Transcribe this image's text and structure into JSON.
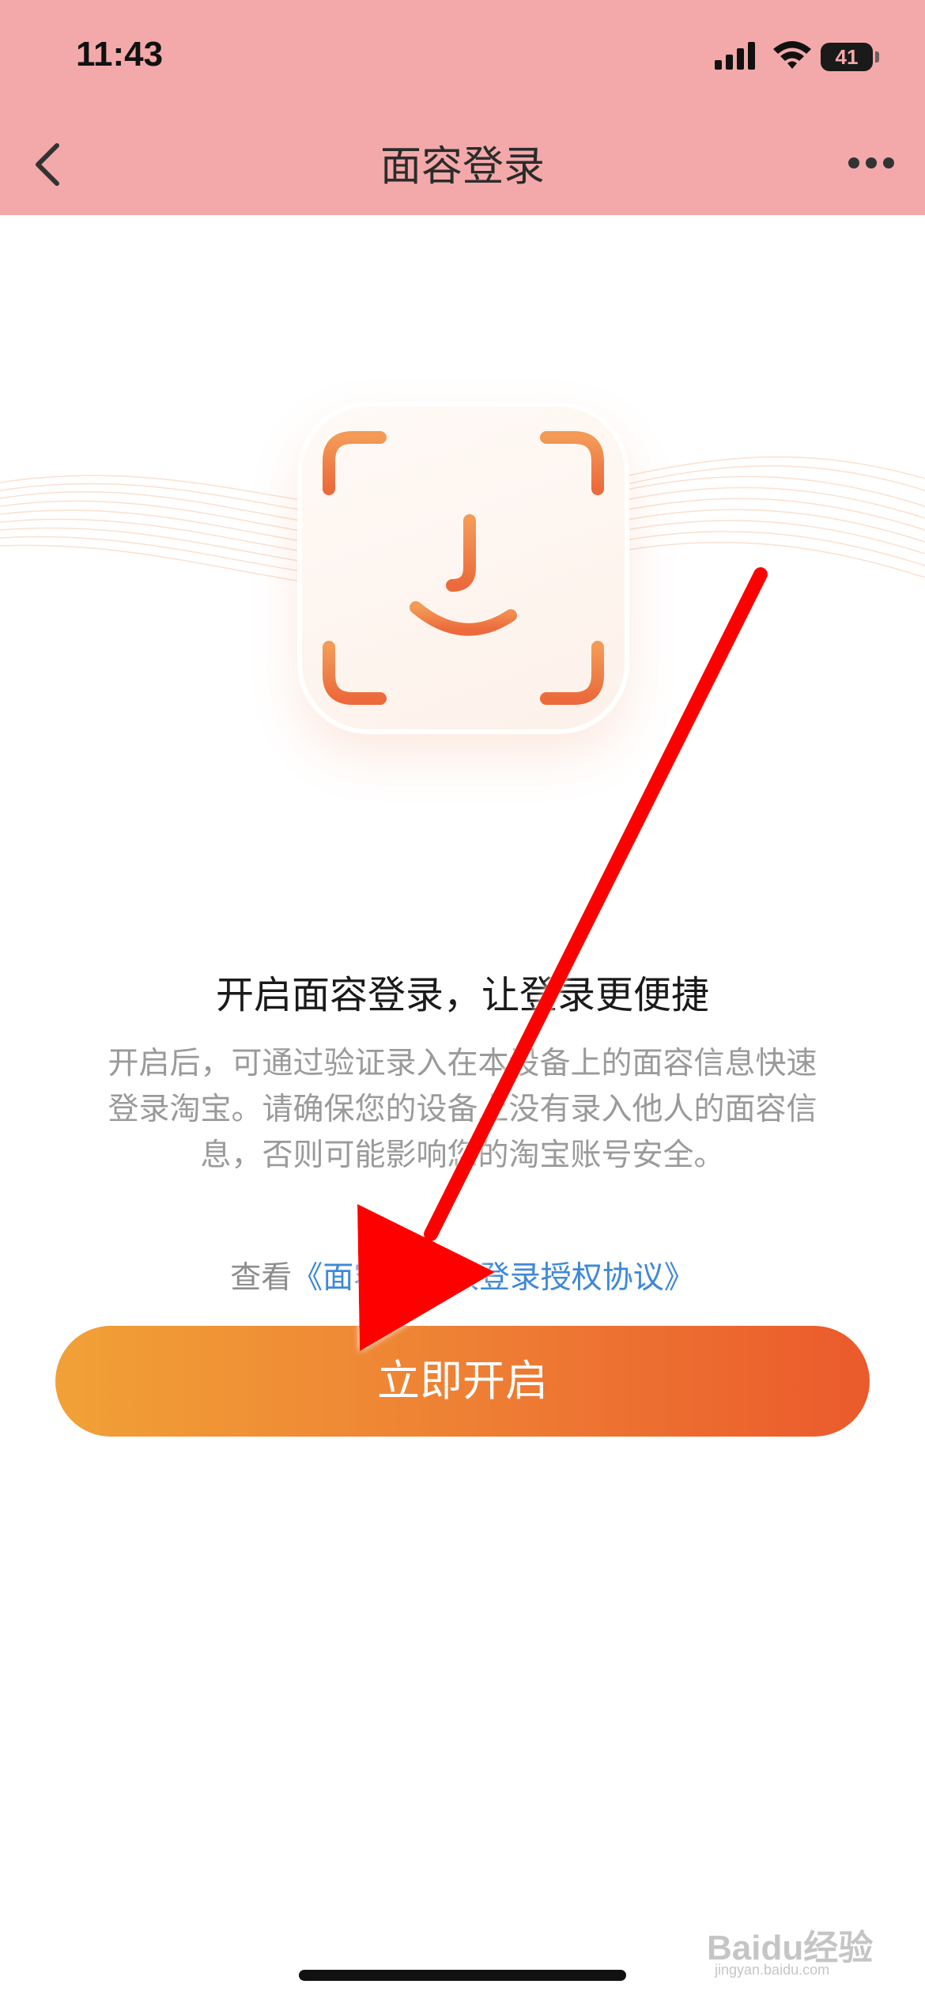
{
  "status_bar": {
    "time": "11:43",
    "battery": "41",
    "icons": [
      "cellular-signal-icon",
      "wifi-icon",
      "battery-icon"
    ]
  },
  "nav": {
    "title": "面容登录",
    "icons": [
      "chevron-left-icon",
      "more-horizontal-icon"
    ]
  },
  "hero": {
    "icon": "face-id-icon"
  },
  "content": {
    "headline": "开启面容登录，让登录更便捷",
    "description": "开启后，可通过验证录入在本设备上的面容信息快速登录淘宝。请确保您的设备上没有录入他人的面容信息，否则可能影响您的淘宝账号安全。",
    "agreement_prefix": "查看",
    "agreement_link": "《面容ID一致登录授权协议》"
  },
  "cta": {
    "label": "立即开启"
  },
  "watermark": {
    "brand": "Baidu经验",
    "sub": "jingyan.baidu.com"
  },
  "colors": {
    "header_bg": "#f3a9aa",
    "cta_start": "#f1a137",
    "cta_end": "#eb5a2c",
    "link": "#3f88d8",
    "annotation_arrow": "#ff0000"
  }
}
